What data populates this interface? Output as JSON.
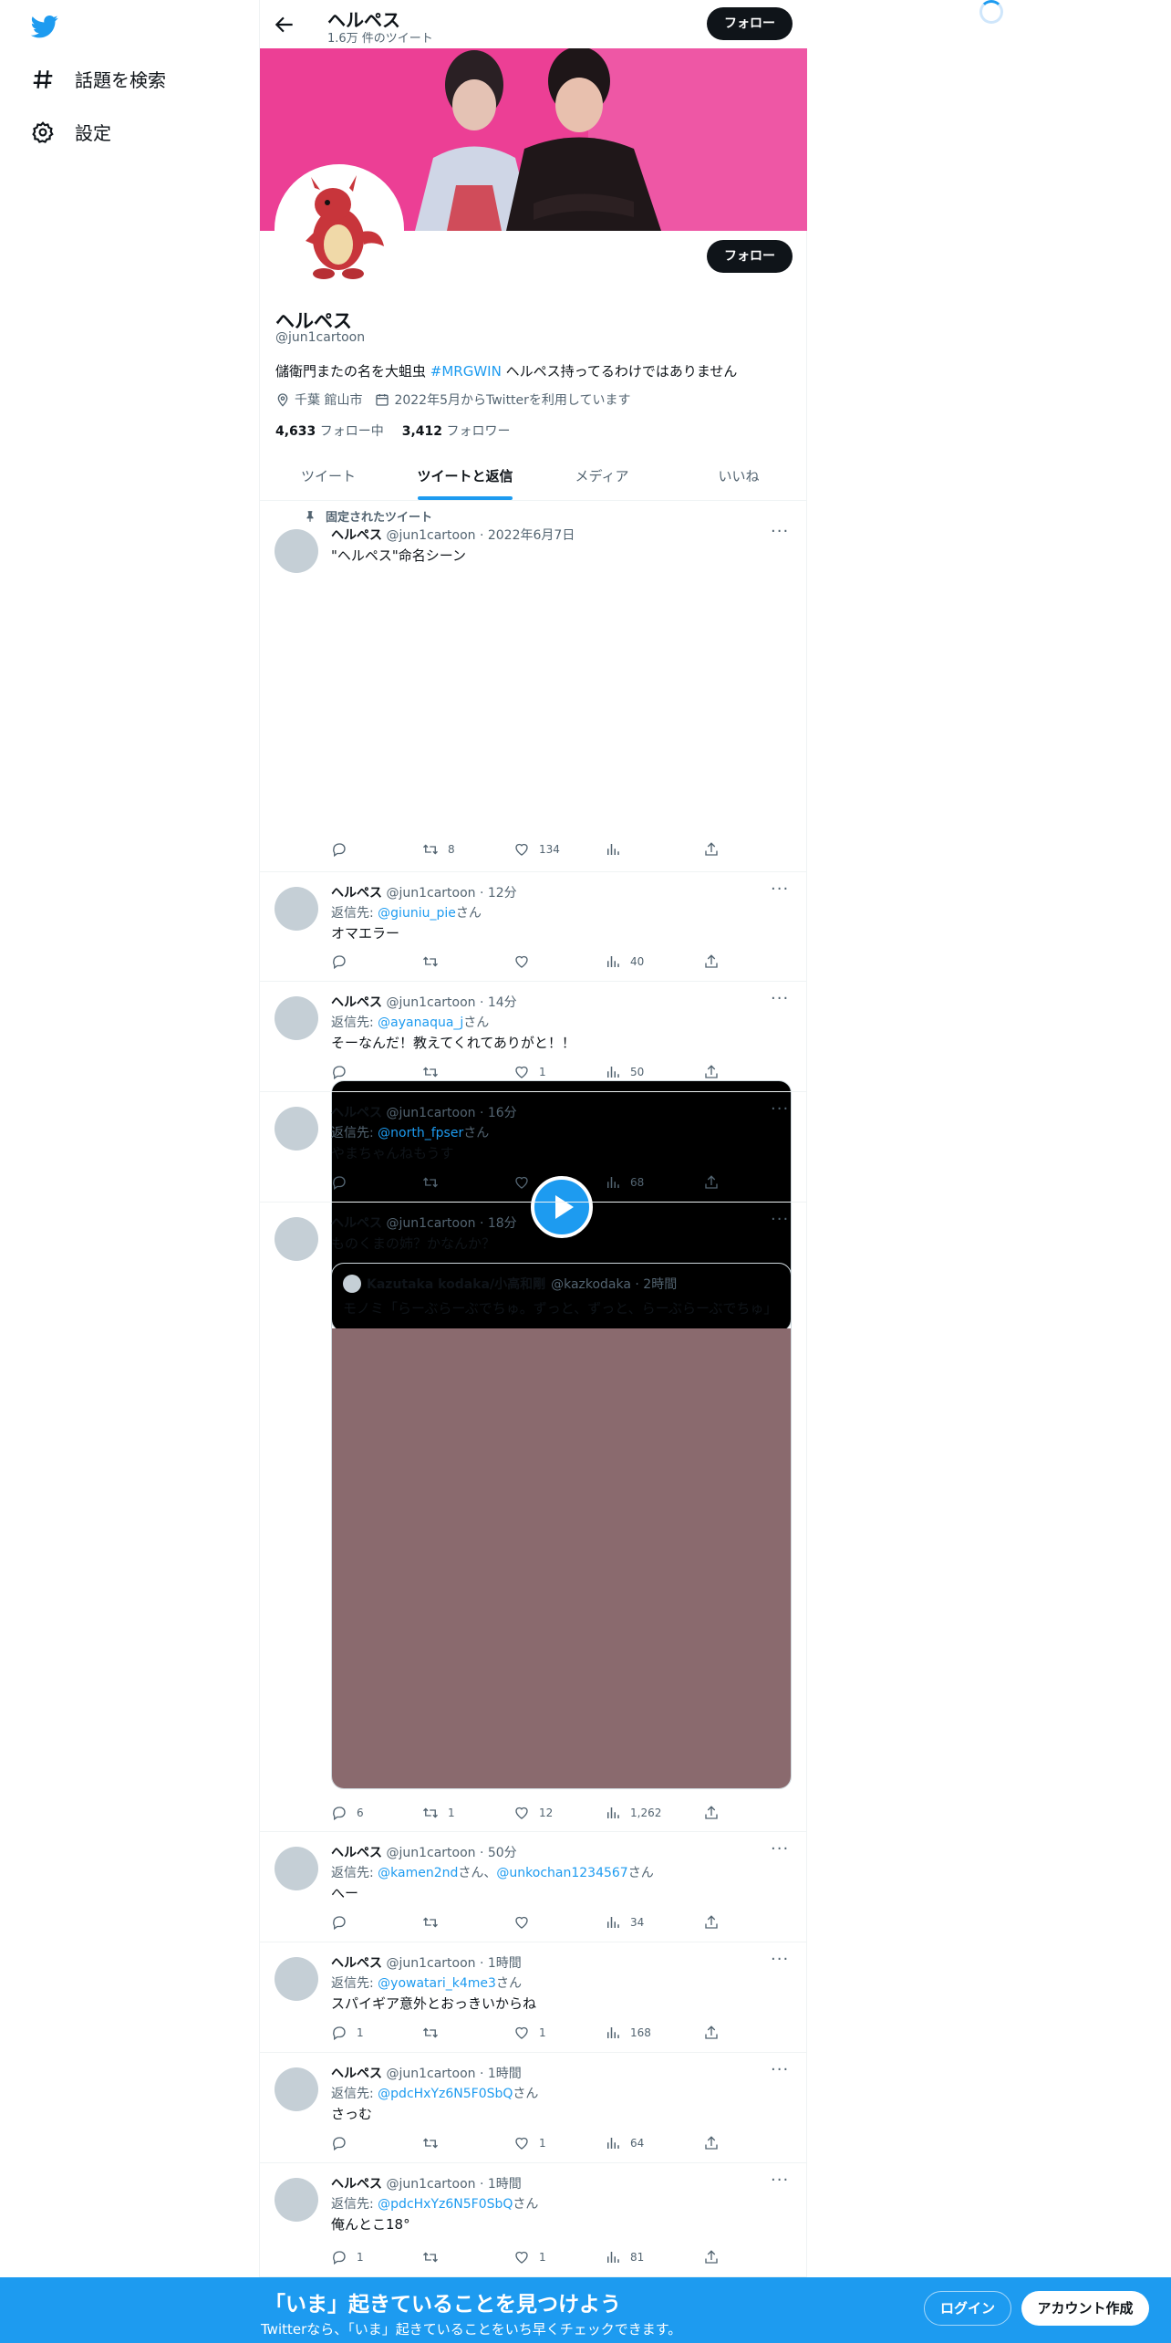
{
  "nav": {
    "explore_label": "話題を検索",
    "settings_label": "設定"
  },
  "header": {
    "name": "ヘルペス",
    "tweet_count": "1.6万 件のツイート",
    "follow_label": "フォロー"
  },
  "profile": {
    "name": "ヘルペス",
    "handle": "@jun1cartoon",
    "bio_prefix": "儲衛門またの名を大蛆虫 ",
    "bio_tag": "#MRGWIN",
    "bio_suffix": " ヘルペス持ってるわけではありません",
    "location": "千葉 館山市",
    "joined": "2022年5月からTwitterを利用しています",
    "following_count": "4,633",
    "following_label": " フォロー中",
    "followers_count": "3,412",
    "followers_label": " フォロワー",
    "follow_label": "フォロー"
  },
  "tabs": [
    "ツイート",
    "ツイートと返信",
    "メディア",
    "いいね"
  ],
  "pinned_label": "固定されたツイート",
  "tweets": [
    {
      "name": "ヘルペス",
      "meta": "@jun1cartoon · 2022年6月7日",
      "text": "\"ヘルペス\"命名シーン",
      "reply_count": "",
      "retweet_count": "8",
      "like_count": "134",
      "view_count": ""
    },
    {
      "name": "ヘルペス",
      "meta": "@jun1cartoon · 12分",
      "reply_prefix": "返信先: ",
      "reply_to": "@giuniu_pie",
      "reply_suffix": "さん",
      "text": "オマエラー",
      "reply_count": "",
      "retweet_count": "",
      "like_count": "",
      "view_count": "40"
    },
    {
      "name": "ヘルペス",
      "meta": "@jun1cartoon · 14分",
      "reply_prefix": "返信先: ",
      "reply_to": "@ayanaqua_j",
      "reply_suffix": "さん",
      "text": "そーなんだ！教えてくれてありがと！！",
      "reply_count": "",
      "retweet_count": "",
      "like_count": "1",
      "view_count": "50"
    },
    {
      "name": "ヘルペス",
      "meta": "@jun1cartoon · 16分",
      "reply_prefix": "返信先: ",
      "reply_to": "@north_fpser",
      "reply_suffix": "さん",
      "text": "やまちゃんねもうす",
      "reply_count": "",
      "retweet_count": "",
      "like_count": "",
      "view_count": "68"
    },
    {
      "name": "ヘルペス",
      "meta": "@jun1cartoon · 18分",
      "text": "ものくまの姉？かなんか？",
      "quote_name": "Kazutaka kodaka/小高和剛",
      "quote_meta": "@kazkodaka · 2時間",
      "quote_text": "モノミ「らーぶらーぶでちゅ。ずっと、ずっと、らーぶらーぶでちゅ」",
      "reply_count": "6",
      "retweet_count": "1",
      "like_count": "12",
      "view_count": "1,262"
    },
    {
      "name": "ヘルペス",
      "meta": "@jun1cartoon · 50分",
      "reply_prefix": "返信先: ",
      "reply_to": "@kamen2nd",
      "reply_mid": "さん、",
      "reply_to2": "@unkochan1234567",
      "reply_suffix": "さん",
      "text": "へー",
      "reply_count": "",
      "retweet_count": "",
      "like_count": "",
      "view_count": "34"
    },
    {
      "name": "ヘルペス",
      "meta": "@jun1cartoon · 1時間",
      "reply_prefix": "返信先: ",
      "reply_to": "@yowatari_k4me3",
      "reply_suffix": "さん",
      "text": "スパイギア意外とおっきいからね",
      "reply_count": "1",
      "retweet_count": "",
      "like_count": "1",
      "view_count": "168"
    },
    {
      "name": "ヘルペス",
      "meta": "@jun1cartoon · 1時間",
      "reply_prefix": "返信先: ",
      "reply_to": "@pdcHxYz6N5F0SbQ",
      "reply_suffix": "さん",
      "text": "さっむ",
      "reply_count": "",
      "retweet_count": "",
      "like_count": "1",
      "view_count": "64"
    },
    {
      "name": "ヘルペス",
      "meta": "@jun1cartoon · 1時間",
      "reply_prefix": "返信先: ",
      "reply_to": "@pdcHxYz6N5F0SbQ",
      "reply_suffix": "さん",
      "text": "俺んとこ18°",
      "reply_count": "1",
      "retweet_count": "",
      "like_count": "1",
      "view_count": "81"
    }
  ],
  "bottom_bar": {
    "title": "「いま」起きていることを見つけよう",
    "subtitle": "Twitterなら、「いま」起きていることをいち早くチェックできます。",
    "login_label": "ログイン",
    "signup_label": "アカウント作成"
  },
  "colors": {
    "accent": "#1d9bf0",
    "dark": "#0f1419",
    "muted": "#536471"
  }
}
